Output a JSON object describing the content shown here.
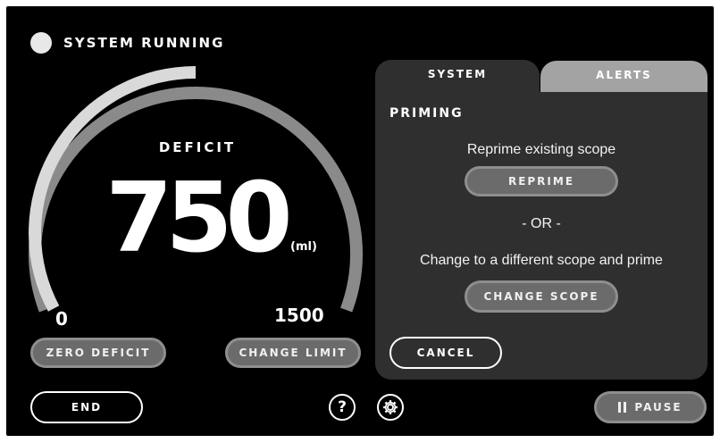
{
  "status": {
    "text": "SYSTEM RUNNING",
    "indicator_color": "#e8e8e8"
  },
  "gauge": {
    "label": "DEFICIT",
    "value": "750",
    "unit": "(ml)",
    "min_label": "0",
    "max_label": "1500",
    "min": 0,
    "max": 1500,
    "current": 750,
    "track_color": "#8a8a8a",
    "fill_color": "#d9d9d9"
  },
  "buttons": {
    "zero_deficit": "ZERO DEFICIT",
    "change_limit": "CHANGE LIMIT",
    "end": "END",
    "pause": "PAUSE",
    "help": "?"
  },
  "panel": {
    "tabs": [
      {
        "label": "SYSTEM",
        "active": true
      },
      {
        "label": "ALERTS",
        "active": false
      }
    ],
    "section_title": "PRIMING",
    "reprime_text": "Reprime existing scope",
    "reprime_button": "REPRIME",
    "or_text": "- OR -",
    "change_text": "Change to a different scope and prime",
    "change_scope_button": "CHANGE SCOPE",
    "cancel_button": "CANCEL"
  },
  "icons": {
    "status": "status-indicator-icon",
    "help": "question-mark-icon",
    "settings": "gear-icon",
    "pause": "pause-icon"
  }
}
